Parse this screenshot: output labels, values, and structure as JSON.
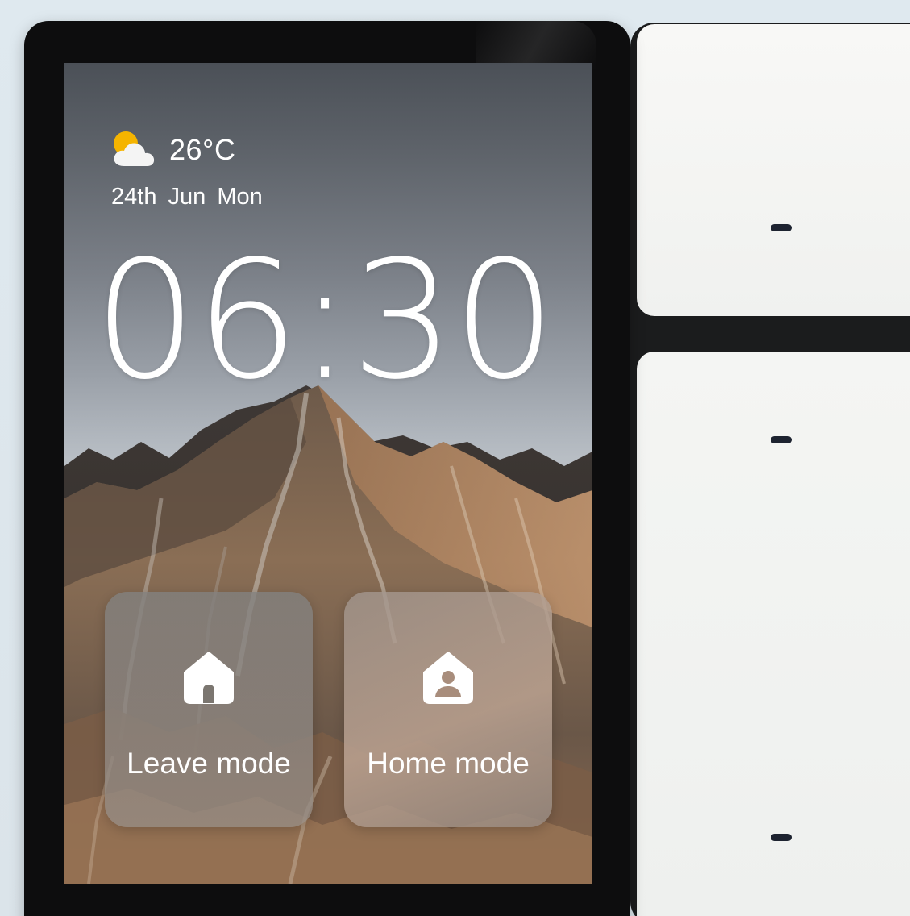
{
  "weather": {
    "icon": "partly-cloudy-icon",
    "temperature": "26°C"
  },
  "date": "24th Jun  Mon",
  "clock": "06:30",
  "modes": [
    {
      "label": "Leave mode",
      "icon": "house-icon"
    },
    {
      "label": "Home mode",
      "icon": "house-person-icon"
    }
  ],
  "switch_keys": [
    {
      "name": "top-switch-key"
    },
    {
      "name": "bottom-switch-key"
    }
  ],
  "colors": {
    "device_bezel": "#0d0d0e",
    "indicator": "#1d2330",
    "sun": "#f5b400",
    "text": "#ffffff"
  }
}
